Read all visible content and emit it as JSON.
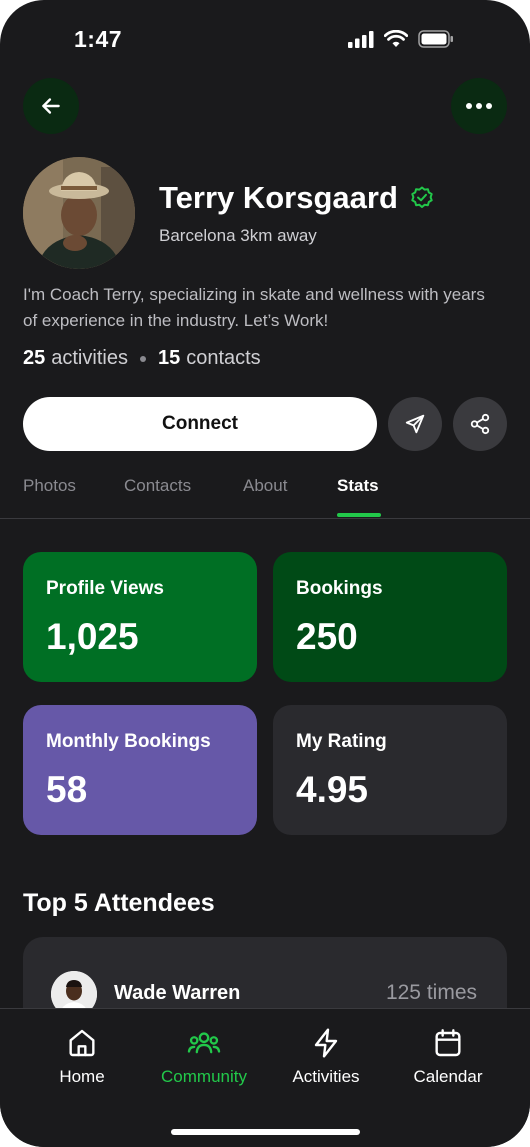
{
  "status_bar": {
    "time": "1:47"
  },
  "profile": {
    "name": "Terry Korsgaard",
    "location": "Barcelona 3km away",
    "bio": "I'm Coach Terry, specializing in skate and wellness with years of experience in the industry. Let’s Work!",
    "activities_count": "25",
    "activities_label": "activities",
    "contacts_count": "15",
    "contacts_label": "contacts"
  },
  "actions": {
    "connect_label": "Connect"
  },
  "tabs": [
    {
      "label": "Photos",
      "active": false
    },
    {
      "label": "Contacts",
      "active": false
    },
    {
      "label": "About",
      "active": false
    },
    {
      "label": "Stats",
      "active": true
    }
  ],
  "stats": [
    {
      "label": "Profile Views",
      "value": "1,025",
      "color": "#006f24"
    },
    {
      "label": "Bookings",
      "value": "250",
      "color": "#004a16"
    },
    {
      "label": "Monthly Bookings",
      "value": "58",
      "color": "#6658a8"
    },
    {
      "label": "My Rating",
      "value": "4.95",
      "color": "#2a2a2e"
    }
  ],
  "attendees": {
    "title": "Top 5 Attendees",
    "items": [
      {
        "name": "Wade Warren",
        "times": "125 times"
      }
    ]
  },
  "bottom_nav": [
    {
      "label": "Home",
      "icon": "home-icon",
      "active": false
    },
    {
      "label": "Community",
      "icon": "community-icon",
      "active": true
    },
    {
      "label": "Activities",
      "icon": "lightning-icon",
      "active": false
    },
    {
      "label": "Calendar",
      "icon": "calendar-icon",
      "active": false
    }
  ],
  "colors": {
    "accent": "#22c84a",
    "background": "#1a1a1c"
  }
}
